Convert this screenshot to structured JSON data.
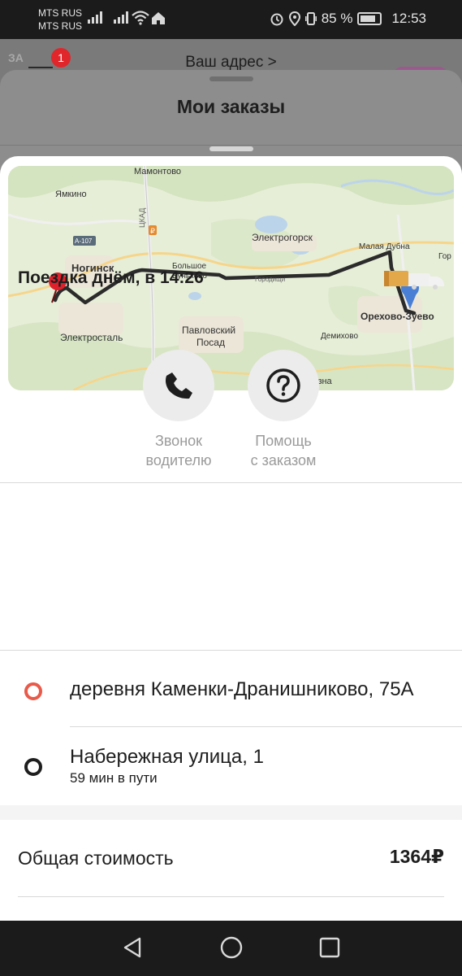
{
  "status_bar": {
    "carrier_1": "MTS RUS",
    "carrier_2": "MTS RUS",
    "battery": "85 %",
    "time": "12:53"
  },
  "background": {
    "badge_count": "1",
    "hint_text": "ЗА",
    "address_link": "Ваш адрес >"
  },
  "orders_sheet": {
    "title": "Мои заказы"
  },
  "map": {
    "labels": {
      "mamontovo": "Мамонтово",
      "yamkino": "Ямкино",
      "a107": "А-107",
      "tskad": "ЦКАД",
      "noginsk": "Ногинск",
      "bolshoe": "Большое",
      "buńkovo": "Буньково",
      "elektrogorsk": "Электрогорск",
      "malaya_dubna": "Малая Дубна",
      "gor": "Гор",
      "elektrostal": "Электросталь",
      "pavlovsky": "Павловский",
      "posad": "Посад",
      "orekhovo": "Орехово-Зуево",
      "demikhovo": "Демихово",
      "drezna": "Дрезна",
      "gorodischi": "Городищи"
    },
    "colors": {
      "route": "#2b2b2b",
      "start_pin": "#e0202a",
      "end_pin": "#4a7fd6"
    }
  },
  "trip": {
    "title": "Поездка днём, в 14:26"
  },
  "actions": [
    {
      "line1": "Звонок",
      "line2": "водителю",
      "icon": "phone-icon"
    },
    {
      "line1": "Помощь",
      "line2": "с заказом",
      "icon": "help-icon"
    }
  ],
  "route_points": {
    "from": "деревня Каменки-Дранишниково, 75А",
    "to": "Набережная улица, 1",
    "to_sub": "59 мин в пути"
  },
  "total": {
    "label": "Общая стоимость",
    "value": "1364₽"
  }
}
